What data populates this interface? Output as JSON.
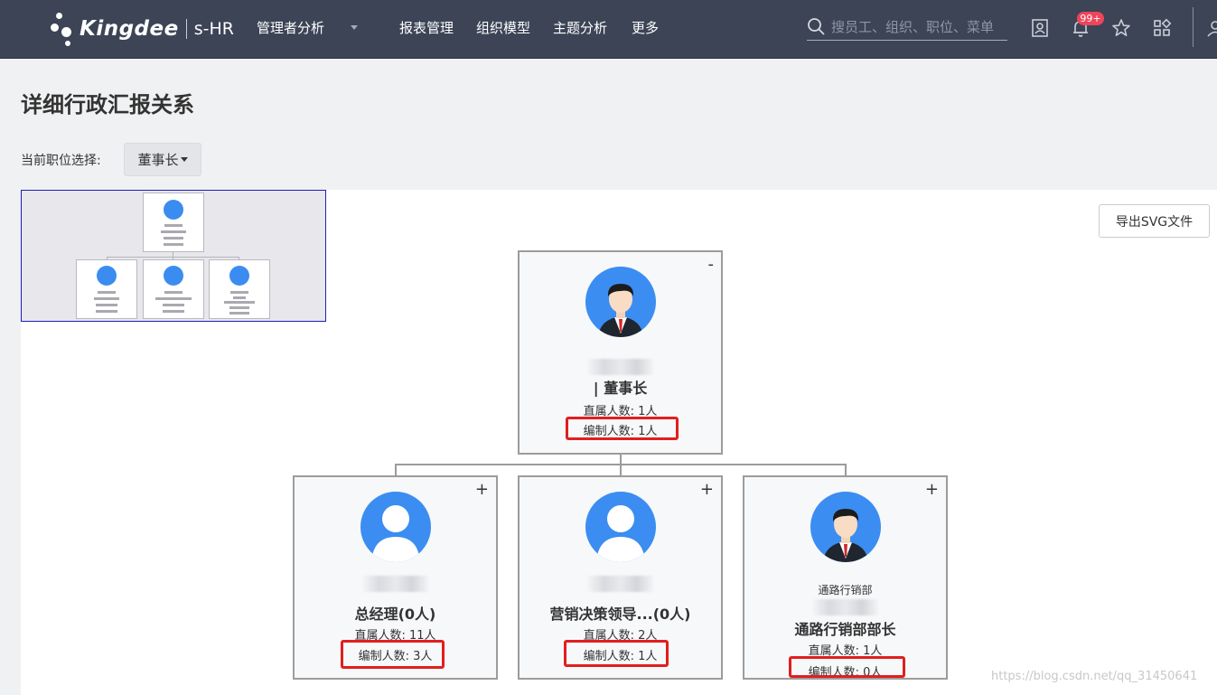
{
  "app": {
    "logo_text": "Kingdee",
    "logo_sub": "s-HR"
  },
  "nav": {
    "items": [
      "管理者分析",
      "报表管理",
      "组织模型",
      "主题分析",
      "更多"
    ]
  },
  "search": {
    "placeholder": "搜员工、组织、职位、菜单"
  },
  "notifications": {
    "badge": "99+"
  },
  "page": {
    "title": "详细行政汇报关系",
    "position_label": "当前职位选择:",
    "position_value": "董事长",
    "export_button": "导出SVG文件"
  },
  "icons": {
    "search": "search-icon",
    "contact": "contact-card-icon",
    "bell": "bell-icon",
    "star": "star-icon",
    "apps": "apps-grid-icon",
    "user": "user-icon",
    "caret": "caret-down-icon"
  },
  "colors": {
    "nav_bg": "#3c4456",
    "avatar_blue": "#3b8df1",
    "highlight_red": "#e21e1e",
    "badge_red": "#f0445a"
  },
  "org": {
    "root": {
      "toggle": "-",
      "title_suffix": "| 董事长",
      "direct_count": "直属人数: 1人",
      "headcount": "编制人数: 1人"
    },
    "children": [
      {
        "toggle": "+",
        "dept": "",
        "title": "总经理(0人)",
        "direct_count": "直属人数: 11人",
        "headcount": "编制人数: 3人"
      },
      {
        "toggle": "+",
        "dept": "",
        "title": "营销决策领导...(0人)",
        "direct_count": "直属人数: 2人",
        "headcount": "编制人数: 1人"
      },
      {
        "toggle": "+",
        "dept": "通路行销部",
        "title": "通路行销部部长",
        "direct_count": "直属人数: 1人",
        "headcount": "编制人数: 0人"
      }
    ]
  },
  "watermark": "https://blog.csdn.net/qq_31450641"
}
